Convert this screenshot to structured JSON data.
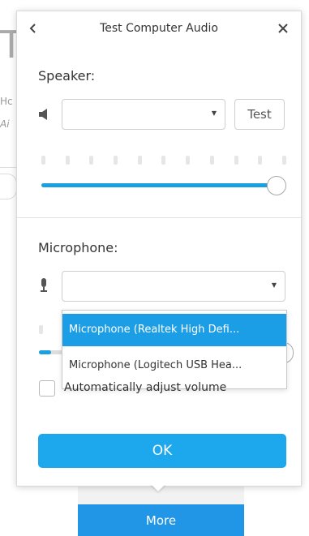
{
  "background": {
    "big_letter": "T",
    "fragment_1": "Hc",
    "fragment_2": "Ai"
  },
  "dialog": {
    "title": "Test Computer Audio",
    "speaker": {
      "label": "Speaker:",
      "selected": "",
      "test_label": "Test",
      "volume": 0.96,
      "level_bars": 11
    },
    "microphone": {
      "label": "Microphone:",
      "selected": "",
      "volume": 0.05,
      "options": [
        "Microphone (Realtek High Defi...",
        "Microphone (Logitech USB Hea..."
      ],
      "highlighted_index": 0
    },
    "auto_adjust_label": "Automatically adjust volume",
    "auto_adjust_checked": false,
    "ok_label": "OK"
  },
  "more_label": "More",
  "colors": {
    "accent": "#1da7ec",
    "more_button": "#2196e6",
    "highlight": "#1c9ee6"
  }
}
